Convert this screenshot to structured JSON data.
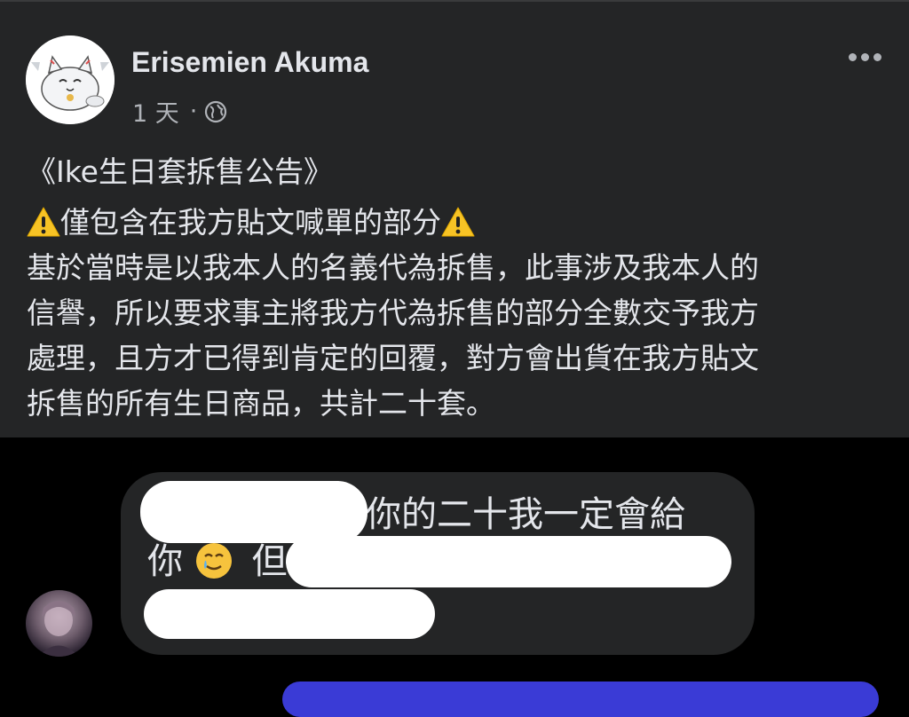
{
  "post": {
    "author": "Erisemien Akuma",
    "time": "1 天",
    "separator": "·",
    "privacy_icon": "globe-icon",
    "more_icon": "more-horizontal-icon",
    "lines": [
      "《Ike生日套拆售公告》",
      "僅包含在我方貼文喊單的部分",
      "基於當時是以我本人的名義代為拆售，此事涉及我本人的",
      "信譽，所以要求事主將我方代為拆售的部分全數交予我方",
      "處理，且方才已得到肯定的回覆，對方會出貨在我方貼文",
      "拆售的所有生日商品，共計二十套。"
    ]
  },
  "message": {
    "line1": "你的二十我一定會給",
    "line2_start": "你",
    "line2_after_emoji": "但",
    "emoji_icon": "smiling-face-with-tear-icon"
  },
  "colors": {
    "post_bg": "#242526",
    "page_bg": "#000000",
    "text": "#e4e6eb",
    "secondary_text": "#b0b3b8",
    "reply_accent": "#3a3bd6"
  }
}
